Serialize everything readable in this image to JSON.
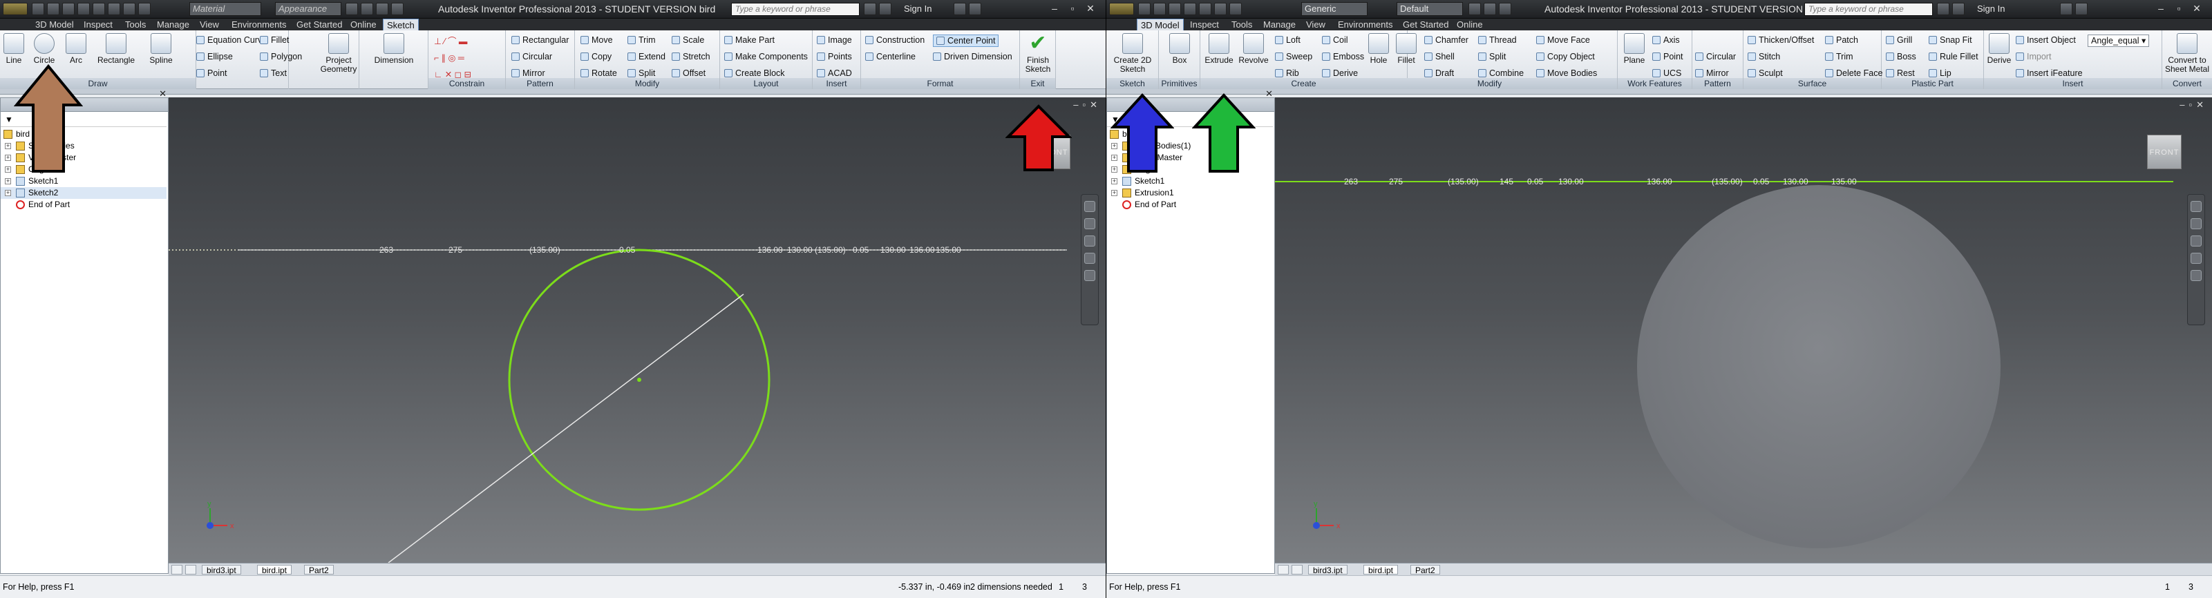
{
  "left": {
    "app_title": "Autodesk Inventor Professional 2013 - STUDENT VERSION  bird",
    "material_combo": "Material",
    "appearance_combo": "Appearance",
    "search_placeholder": "Type a keyword or phrase",
    "sign_in": "Sign In",
    "tabs": [
      "3D Model",
      "Inspect",
      "Tools",
      "Manage",
      "View",
      "Environments",
      "Get Started",
      "Online",
      "Sketch"
    ],
    "draw_tools": [
      "Line",
      "Circle",
      "Arc",
      "Rectangle",
      "Spline"
    ],
    "draw_small": [
      "Equation Curve",
      "Ellipse",
      "Point",
      "Fillet",
      "Polygon",
      "Text"
    ],
    "project_geometry": "Project Geometry",
    "dimension": "Dimension",
    "pattern_tools": [
      "Rectangular",
      "Circular",
      "Mirror"
    ],
    "modify_tools": [
      "Move",
      "Copy",
      "Rotate",
      "Trim",
      "Extend",
      "Split",
      "Scale",
      "Stretch",
      "Offset"
    ],
    "layout_tools": [
      "Make Part",
      "Make Components",
      "Create Block"
    ],
    "insert_tools": [
      "Image",
      "Points",
      "ACAD"
    ],
    "format_tools": [
      "Construction",
      "Centerline",
      "Center Point",
      "Driven Dimension"
    ],
    "finish_sketch": "Finish Sketch",
    "group_labels": [
      "Draw",
      "Constrain",
      "Pattern",
      "Modify",
      "Layout",
      "Insert",
      "Format",
      "Exit"
    ],
    "tree": [
      "bird",
      "Solid Bodies",
      "View: Master",
      "Origin",
      "Sketch1",
      "Sketch2",
      "End of Part"
    ],
    "sketch_dims": [
      "263",
      "275",
      "(135.00)",
      "0.05",
      "136.00",
      "130.00",
      "(135.00)",
      "0.05",
      "130.00",
      "136.00",
      "135.00"
    ],
    "doc_tabs": [
      "bird3.ipt",
      "bird.ipt",
      "Part2"
    ],
    "status_help": "For Help, press F1",
    "status_coords": "-5.337 in, -0.469 in",
    "status_dims": "2 dimensions needed",
    "status_num1": "1",
    "status_num2": "3",
    "viewcube_label": "FRONT"
  },
  "right": {
    "app_title": "Autodesk Inventor Professional 2013 - STUDENT VERSION  bird",
    "generic_combo": "Generic",
    "default_combo": "Default",
    "search_placeholder": "Type a keyword or phrase",
    "sign_in": "Sign In",
    "tabs": [
      "3D Model",
      "Inspect",
      "Tools",
      "Manage",
      "View",
      "Environments",
      "Get Started",
      "Online"
    ],
    "big_tools": [
      "Create 2D Sketch",
      "Box",
      "Extrude",
      "Revolve",
      "Hole",
      "Fillet"
    ],
    "create_small": [
      "Loft",
      "Sweep",
      "Rib",
      "Coil",
      "Emboss",
      "Derive"
    ],
    "modify_small": [
      "Chamfer",
      "Shell",
      "Draft",
      "Thread",
      "Split",
      "Combine",
      "Move Face",
      "Copy Object",
      "Move Bodies"
    ],
    "plane": "Plane",
    "work_small": [
      "Axis",
      "Point",
      "UCS"
    ],
    "pattern_small": [
      "Circular",
      "Mirror"
    ],
    "surface_small": [
      "Thicken/Offset",
      "Stitch",
      "Sculpt",
      "Patch",
      "Trim",
      "Delete Face"
    ],
    "plastic_small": [
      "Grill",
      "Boss",
      "Rest",
      "Snap Fit",
      "Rule Fillet",
      "Lip"
    ],
    "insert_small": [
      "Derive",
      "Insert Object",
      "Import",
      "Insert iFeature"
    ],
    "angle_combo": "Angle_equal",
    "convert": "Convert to Sheet Metal",
    "group_labels": [
      "Sketch",
      "Primitives",
      "Create",
      "Modify",
      "Work Features",
      "Pattern",
      "Surface",
      "Plastic Part",
      "Insert",
      "Convert"
    ],
    "tree": [
      "bird",
      "Solid Bodies(1)",
      "View: Master",
      "Origin",
      "Sketch1",
      "Extrusion1",
      "End of Part"
    ],
    "sketch_dims": [
      "263",
      "275",
      "(135.00)",
      "145",
      "0.05",
      "130.00",
      "136.00",
      "(135.00)",
      "0.05",
      "130.00",
      "135.00"
    ],
    "doc_tabs": [
      "bird3.ipt",
      "bird.ipt",
      "Part2"
    ],
    "status_help": "For Help, press F1",
    "status_num1": "1",
    "status_num2": "3",
    "viewcube_label": "FRONT"
  },
  "colors": {
    "arrow_brown": "#b07a57",
    "arrow_red": "#e01818",
    "arrow_blue": "#2b2fd8",
    "arrow_green": "#1fb83a",
    "sketch_green": "#7cdd1a"
  }
}
